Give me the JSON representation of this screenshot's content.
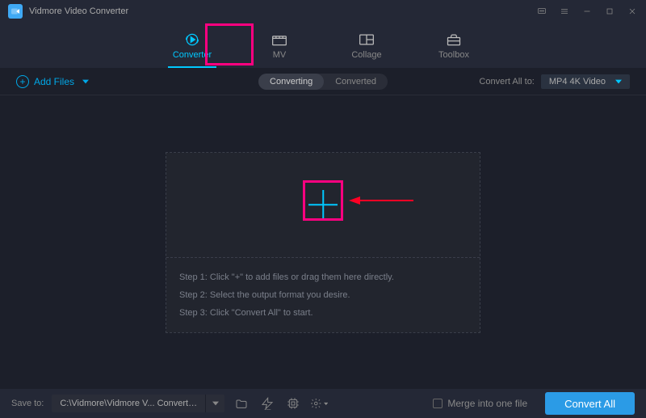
{
  "app": {
    "title": "Vidmore Video Converter"
  },
  "nav": {
    "tabs": [
      {
        "label": "Converter",
        "active": true
      },
      {
        "label": "MV",
        "active": false
      },
      {
        "label": "Collage",
        "active": false
      },
      {
        "label": "Toolbox",
        "active": false
      }
    ]
  },
  "toolbar": {
    "add_files": "Add Files",
    "segments": {
      "converting": "Converting",
      "converted": "Converted"
    },
    "convert_all_to_label": "Convert All to:",
    "convert_all_to_value": "MP4 4K Video"
  },
  "dropzone": {
    "steps": [
      "Step 1: Click \"+\" to add files or drag them here directly.",
      "Step 2: Select the output format you desire.",
      "Step 3: Click \"Convert All\" to start."
    ]
  },
  "bottom": {
    "save_to_label": "Save to:",
    "save_path": "C:\\Vidmore\\Vidmore V... Converter\\Converted",
    "merge_label": "Merge into one file",
    "convert_button": "Convert All"
  },
  "colors": {
    "accent": "#00c8ff",
    "highlight": "#ff0080",
    "primary_button": "#2b9be6"
  }
}
